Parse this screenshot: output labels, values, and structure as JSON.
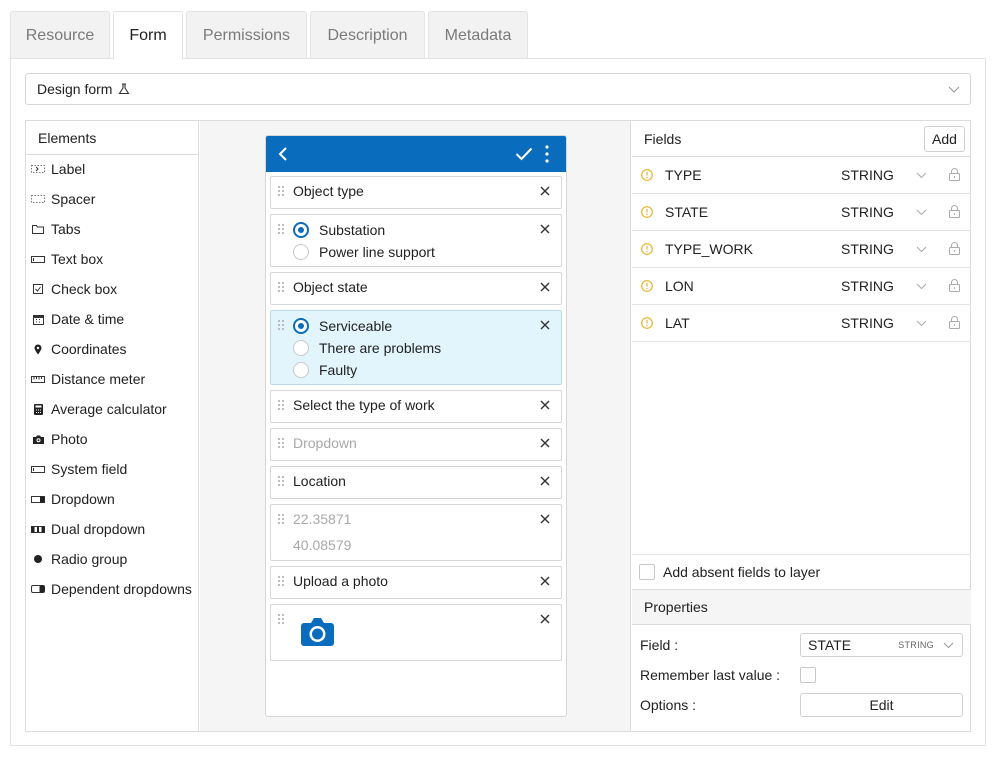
{
  "tabs": [
    {
      "label": "Resource",
      "active": false
    },
    {
      "label": "Form",
      "active": true
    },
    {
      "label": "Permissions",
      "active": false
    },
    {
      "label": "Description",
      "active": false
    },
    {
      "label": "Metadata",
      "active": false
    }
  ],
  "design_select": {
    "value": "Design form",
    "icon": "flask-icon"
  },
  "elements": {
    "title": "Elements",
    "items": [
      {
        "label": "Label",
        "icon": "label-icon"
      },
      {
        "label": "Spacer",
        "icon": "spacer-icon"
      },
      {
        "label": "Tabs",
        "icon": "tabs-icon"
      },
      {
        "label": "Text box",
        "icon": "textbox-icon"
      },
      {
        "label": "Check box",
        "icon": "checkbox-icon"
      },
      {
        "label": "Date & time",
        "icon": "calendar-icon"
      },
      {
        "label": "Coordinates",
        "icon": "pin-icon"
      },
      {
        "label": "Distance meter",
        "icon": "ruler-icon"
      },
      {
        "label": "Average calculator",
        "icon": "calculator-icon"
      },
      {
        "label": "Photo",
        "icon": "camera-icon"
      },
      {
        "label": "System field",
        "icon": "system-field-icon"
      },
      {
        "label": "Dropdown",
        "icon": "dropdown-icon"
      },
      {
        "label": "Dual dropdown",
        "icon": "dual-dropdown-icon"
      },
      {
        "label": "Radio group",
        "icon": "radio-icon"
      },
      {
        "label": "Dependent dropdowns",
        "icon": "dependent-dropdown-icon"
      }
    ]
  },
  "form": {
    "label_object_type": "Object type",
    "radio1": [
      "Substation",
      "Power line support"
    ],
    "label_object_state": "Object state",
    "radio2": [
      "Serviceable",
      "There are problems",
      "Faulty"
    ],
    "label_work": "Select the type of work",
    "dropdown_placeholder": "Dropdown",
    "label_location": "Location",
    "coord_lat": "22.35871",
    "coord_lon": "40.08579",
    "label_photo": "Upload a photo"
  },
  "fields": {
    "title": "Fields",
    "add_label": "Add",
    "rows": [
      {
        "name": "TYPE",
        "type": "STRING"
      },
      {
        "name": "STATE",
        "type": "STRING"
      },
      {
        "name": "TYPE_WORK",
        "type": "STRING"
      },
      {
        "name": "LON",
        "type": "STRING"
      },
      {
        "name": "LAT",
        "type": "STRING"
      }
    ],
    "absent_label": "Add absent fields to layer"
  },
  "properties": {
    "title": "Properties",
    "field_label": "Field :",
    "field_value": "STATE",
    "field_type": "STRING",
    "remember_label": "Remember last value :",
    "options_label": "Options :",
    "edit_label": "Edit"
  },
  "colors": {
    "accent": "#0a6cbd",
    "selected_bg": "#e2f5fd",
    "warning": "#e8b326"
  }
}
